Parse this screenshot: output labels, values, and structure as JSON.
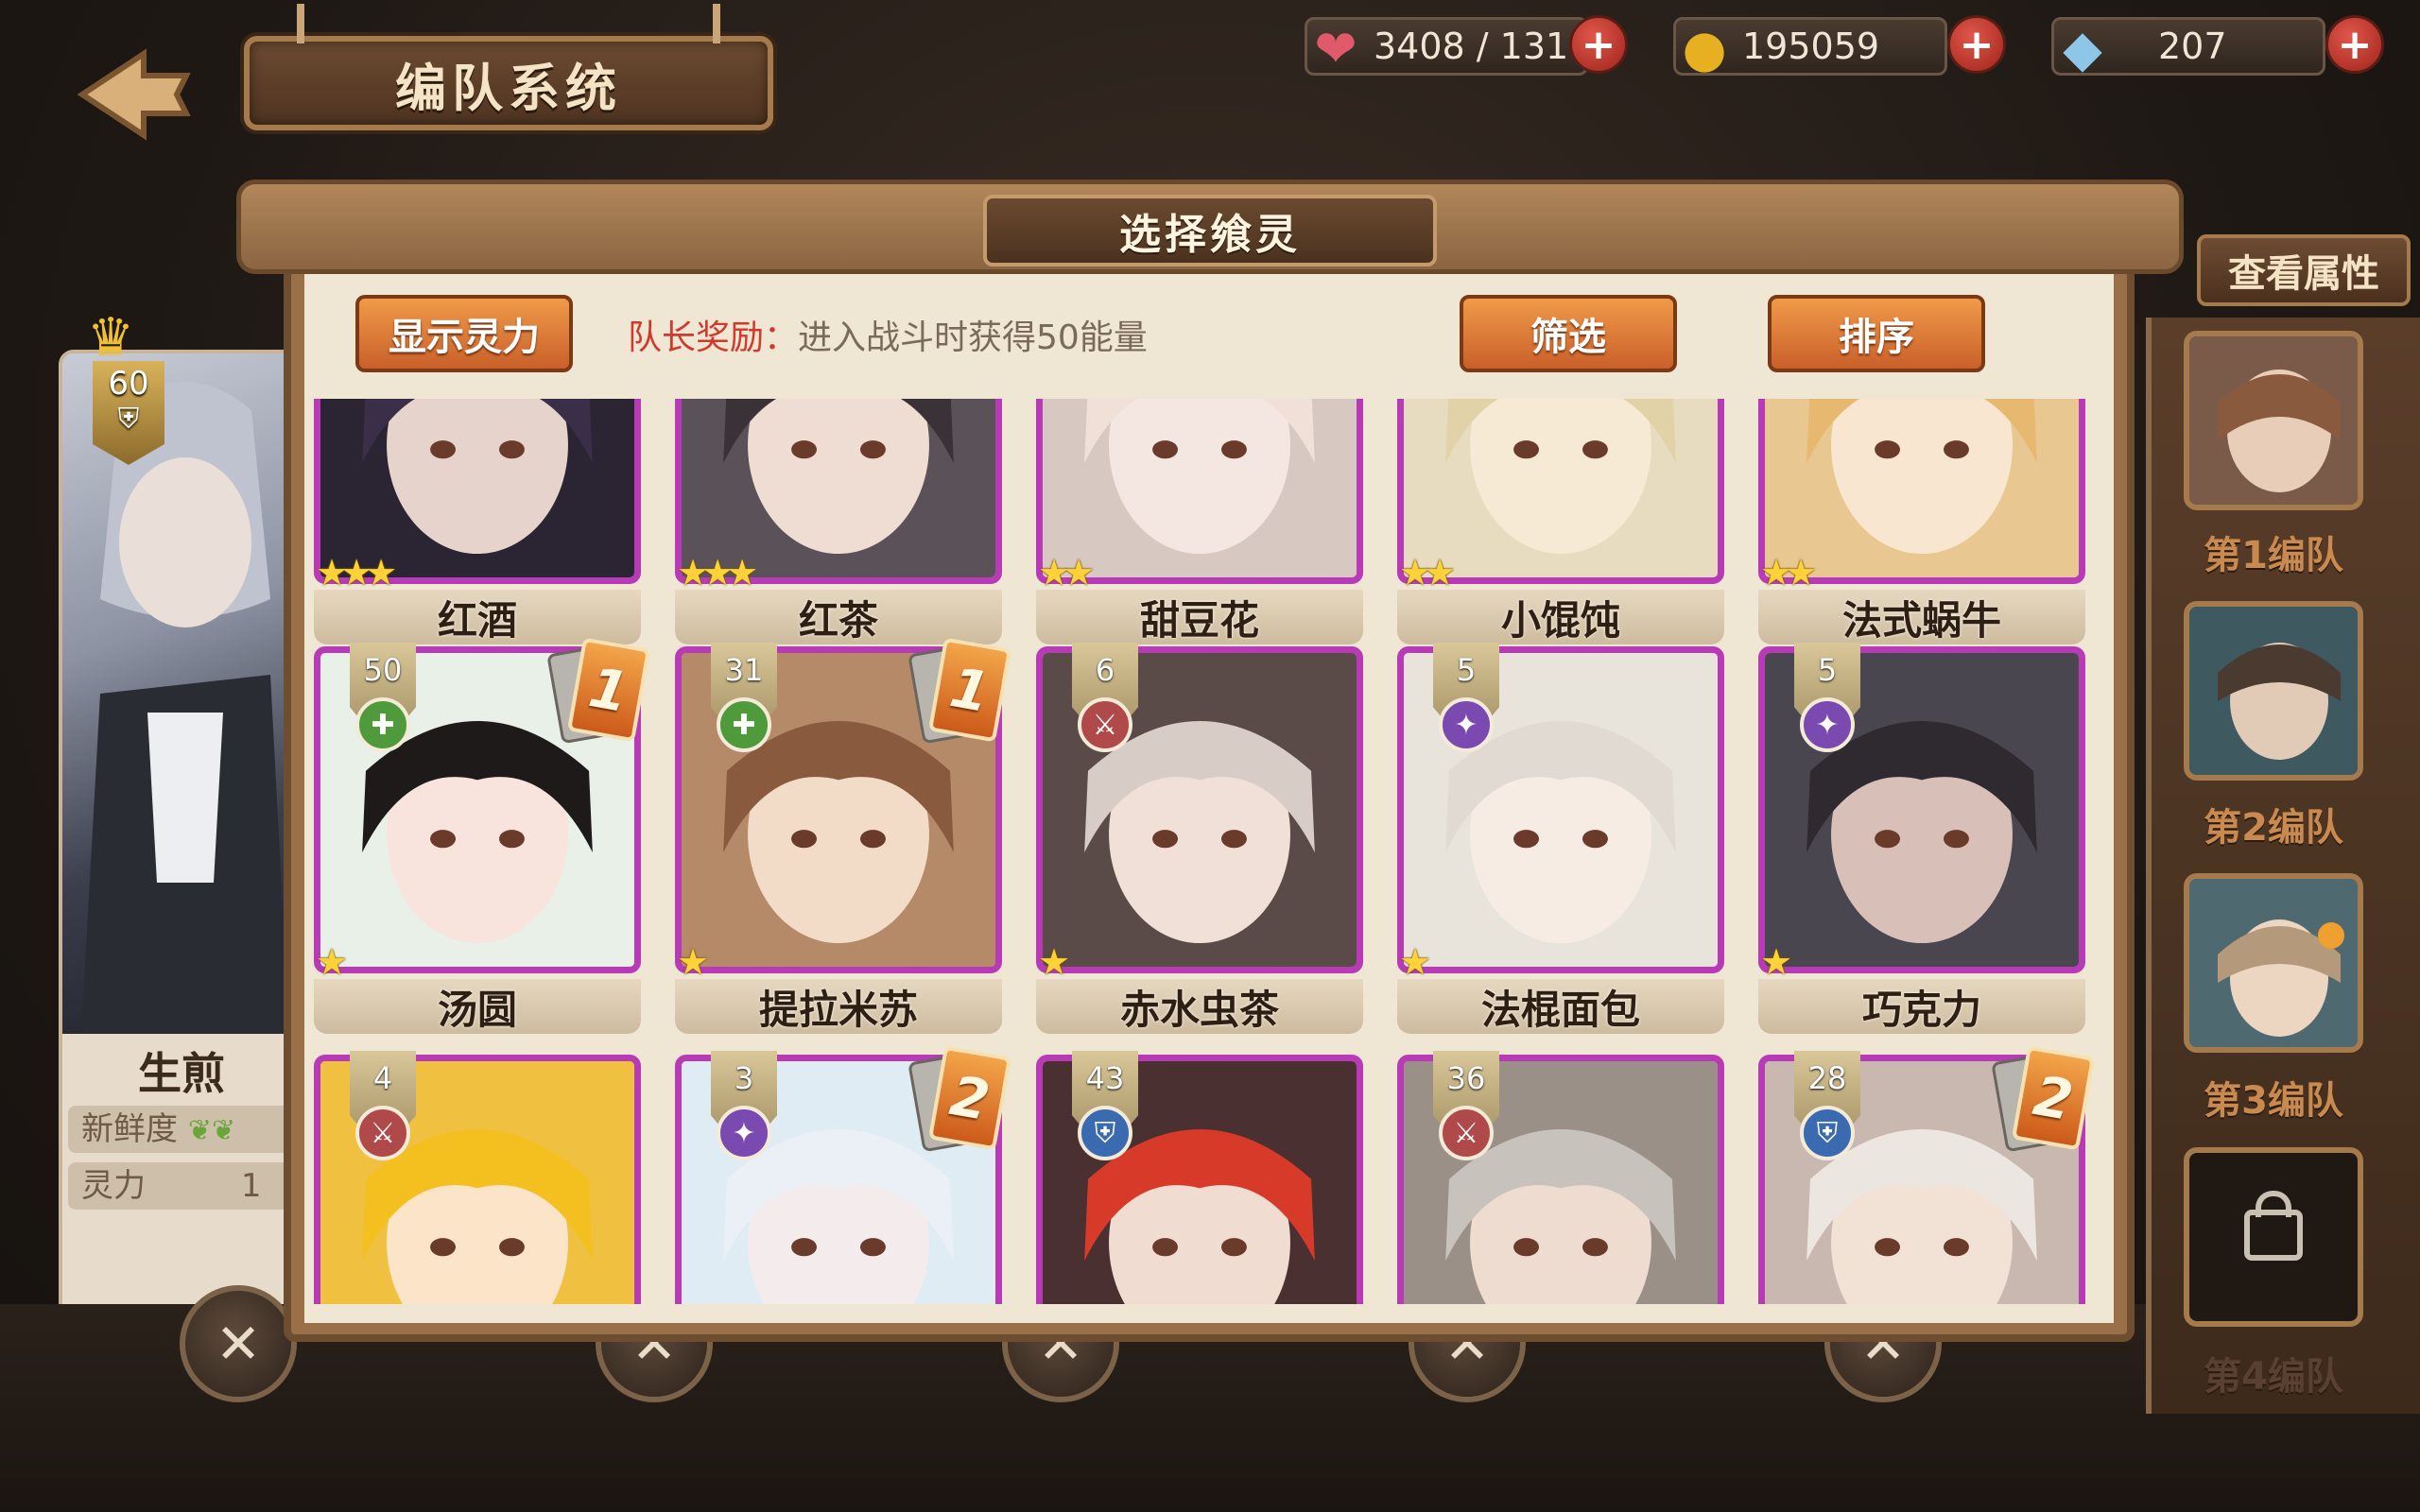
{
  "header": {
    "title": "编队系统",
    "stamina": "3408 / 131",
    "gold": "195059",
    "gems": "207",
    "plus_label": "+"
  },
  "leader": {
    "level": "60",
    "name": "生煎",
    "freshness_label": "新鲜度",
    "spirit_label": "灵力",
    "spirit_value": "1"
  },
  "modal": {
    "title": "选择飨灵",
    "show_power_label": "显示灵力",
    "leader_bonus_label": "队长奖励：",
    "leader_bonus_text": "进入战斗时获得50能量",
    "filter_label": "筛选",
    "sort_label": "排序"
  },
  "right_panel": {
    "view_attributes_label": "查看属性",
    "teams": [
      {
        "label": "第1编队"
      },
      {
        "label": "第2编队"
      },
      {
        "label": "第3编队"
      },
      {
        "label": "第4编队"
      }
    ]
  },
  "cards": [
    {
      "name": "红酒",
      "stars": "★★★",
      "level": "",
      "role": "",
      "team": ""
    },
    {
      "name": "红茶",
      "stars": "★★★",
      "level": "",
      "role": "",
      "team": ""
    },
    {
      "name": "甜豆花",
      "stars": "★★",
      "level": "",
      "role": "",
      "team": ""
    },
    {
      "name": "小馄饨",
      "stars": "★★",
      "level": "",
      "role": "",
      "team": ""
    },
    {
      "name": "法式蜗牛",
      "stars": "★★",
      "level": "",
      "role": "",
      "team": ""
    },
    {
      "name": "汤圆",
      "stars": "★",
      "level": "50",
      "role": "heal",
      "team": "1"
    },
    {
      "name": "提拉米苏",
      "stars": "★",
      "level": "31",
      "role": "heal",
      "team": "1"
    },
    {
      "name": "赤水虫茶",
      "stars": "★",
      "level": "6",
      "role": "attack",
      "team": ""
    },
    {
      "name": "法棍面包",
      "stars": "★",
      "level": "5",
      "role": "magic",
      "team": ""
    },
    {
      "name": "巧克力",
      "stars": "★",
      "level": "5",
      "role": "magic",
      "team": ""
    },
    {
      "name": "",
      "stars": "",
      "level": "4",
      "role": "attack",
      "team": ""
    },
    {
      "name": "",
      "stars": "",
      "level": "3",
      "role": "magic",
      "team": "2"
    },
    {
      "name": "",
      "stars": "",
      "level": "43",
      "role": "defense",
      "team": ""
    },
    {
      "name": "",
      "stars": "",
      "level": "36",
      "role": "attack",
      "team": ""
    },
    {
      "name": "",
      "stars": "",
      "level": "28",
      "role": "defense",
      "team": "2"
    }
  ]
}
